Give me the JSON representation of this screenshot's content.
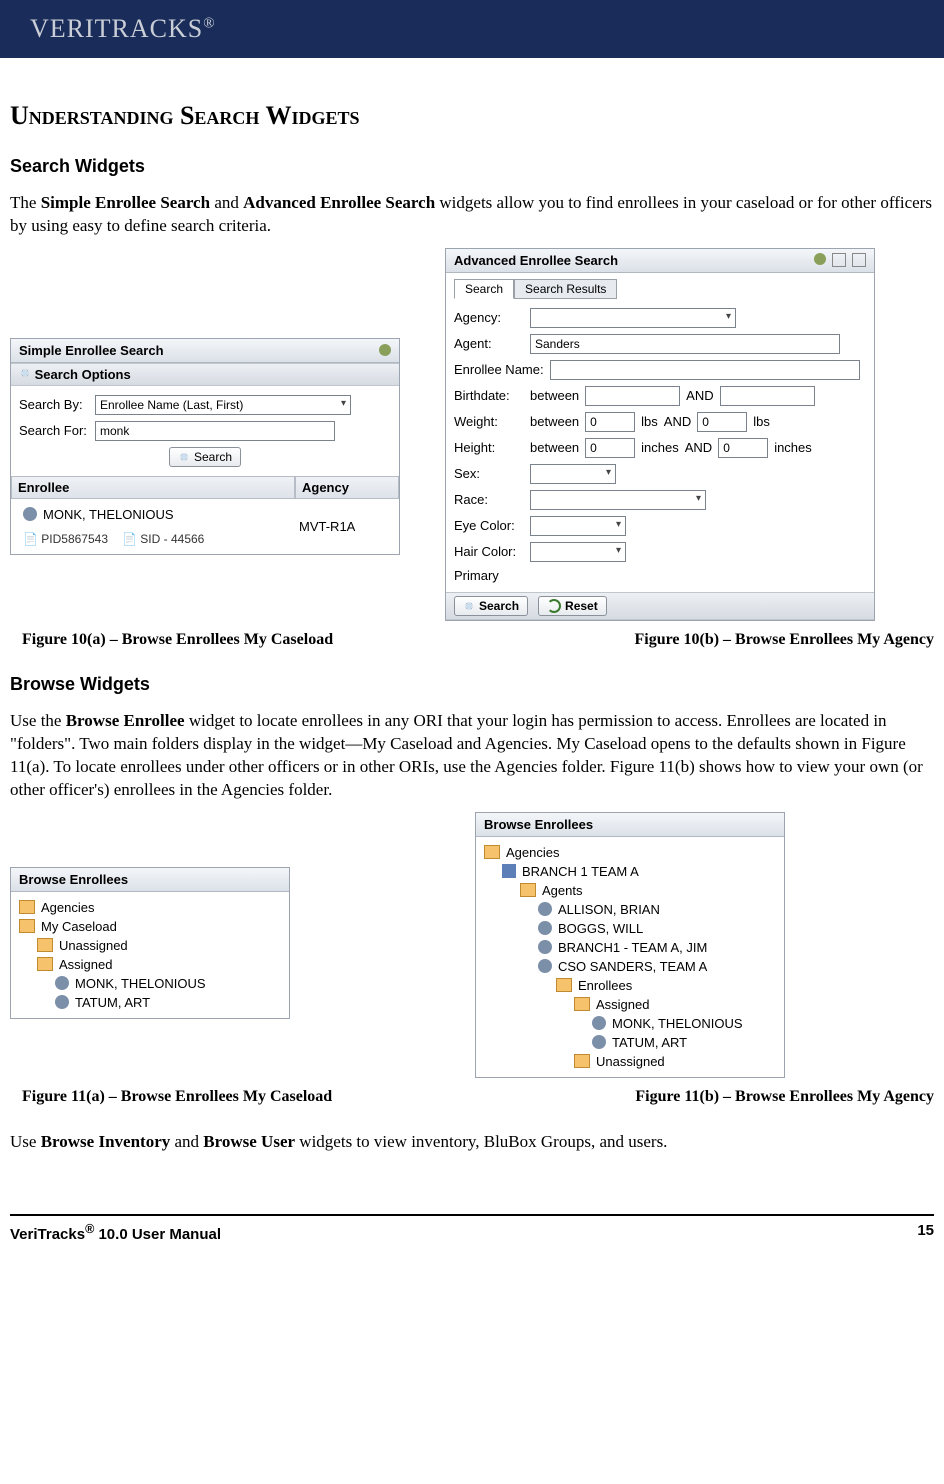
{
  "brand": "VERITRACKS",
  "brand_mark": "®",
  "headings": {
    "main": "Understanding Search Widgets",
    "search": "Search Widgets",
    "browse": "Browse Widgets"
  },
  "para1": {
    "pre": "The ",
    "b1": "Simple Enrollee Search",
    "mid": " and ",
    "b2": "Advanced Enrollee Search",
    "post": " widgets allow you to find enrollees in your caseload or for other officers by using easy to define search criteria."
  },
  "simple": {
    "title": "Simple Enrollee Search",
    "options": "Search Options",
    "by_label": "Search By:",
    "by_value": "Enrollee Name (Last, First)",
    "for_label": "Search For:",
    "for_value": "monk",
    "search_btn": "Search",
    "col_enrollee": "Enrollee",
    "col_agency": "Agency",
    "row_name": "MONK, THELONIOUS",
    "row_pid": "PID5867543",
    "row_sid": "SID - 44566",
    "row_agency": "MVT-R1A"
  },
  "advanced": {
    "title": "Advanced Enrollee Search",
    "tab_search": "Search",
    "tab_results": "Search Results",
    "agency_label": "Agency:",
    "agent_label": "Agent:",
    "agent_value": "Sanders",
    "enrollee_label": "Enrollee Name:",
    "birth_label": "Birthdate:",
    "between": "between",
    "and": "AND",
    "weight_label": "Weight:",
    "weight_unit": "lbs",
    "weight_val": "0",
    "height_label": "Height:",
    "height_unit": "inches",
    "height_val": "0",
    "sex_label": "Sex:",
    "race_label": "Race:",
    "eye_label": "Eye Color:",
    "hair_label": "Hair Color:",
    "primary_label": "Primary",
    "search_btn": "Search",
    "reset_btn": "Reset"
  },
  "captions": {
    "f10a": "Figure 10(a) – Browse Enrollees My Caseload",
    "f10b": "Figure 10(b) – Browse Enrollees My Agency",
    "f11a": "Figure 11(a) – Browse Enrollees My Caseload",
    "f11b": "Figure 11(b) – Browse Enrollees My Agency"
  },
  "para2": {
    "pre": "Use the ",
    "b1": "Browse Enrollee",
    "post": " widget to locate enrollees in any ORI that your login has permission to access.  Enrollees are located in \"folders\".  Two main folders display in the widget—My Caseload and Agencies.  My Caseload opens to the defaults shown in Figure 11(a).  To locate enrollees under other officers or in other ORIs, use the Agencies folder.  Figure 11(b) shows how to view your own (or other officer's) enrollees in the Agencies folder."
  },
  "browseA": {
    "title": "Browse Enrollees",
    "items": [
      "Agencies",
      "My Caseload",
      "Unassigned",
      "Assigned",
      "MONK, THELONIOUS",
      "TATUM, ART"
    ]
  },
  "browseB": {
    "title": "Browse Enrollees",
    "items": [
      "Agencies",
      "BRANCH 1 TEAM A",
      "Agents",
      "ALLISON, BRIAN",
      "BOGGS, WILL",
      "BRANCH1 - TEAM A, JIM",
      "CSO SANDERS, TEAM A",
      "Enrollees",
      "Assigned",
      "MONK, THELONIOUS",
      "TATUM, ART",
      "Unassigned"
    ]
  },
  "para3": {
    "pre": "Use ",
    "b1": "Browse Inventory",
    "mid": " and ",
    "b2": "Browse User",
    "post": " widgets to view inventory, BluBox Groups, and users."
  },
  "footer": {
    "left_pre": "VeriTracks",
    "left_sup": "®",
    "left_post": " 10.0 User Manual",
    "page": "15"
  }
}
